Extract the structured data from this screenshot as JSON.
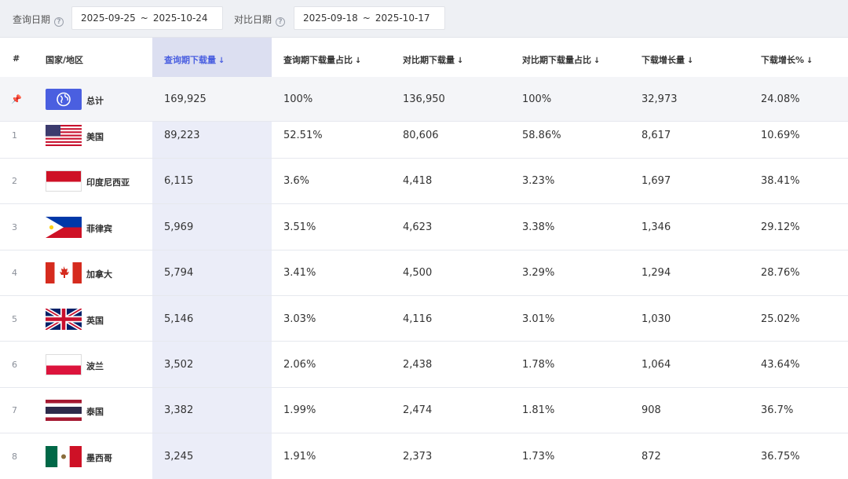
{
  "filters": {
    "query_label": "查询日期",
    "query_start": "2025-09-25",
    "query_end": "2025-10-24",
    "compare_label": "对比日期",
    "compare_start": "2025-09-18",
    "compare_end": "2025-10-17",
    "range_separator": "~"
  },
  "table": {
    "headers": {
      "index": "#",
      "country": "国家/地区",
      "query_downloads": "查询期下载量",
      "query_share": "查询期下载量占比",
      "compare_downloads": "对比期下载量",
      "compare_share": "对比期下载量占比",
      "growth": "下载增长量",
      "growth_pct": "下载增长%"
    },
    "sort_arrow": "↓",
    "total": {
      "name": "总计",
      "flag_icon": "globe-icon",
      "query": "169,925",
      "query_share": "100%",
      "compare": "136,950",
      "compare_share": "100%",
      "growth": "32,973",
      "growth_pct": "24.08%"
    },
    "rows": [
      {
        "index": "1",
        "name": "美国",
        "flag_icon": "flag-us-icon",
        "query": "89,223",
        "query_share": "52.51%",
        "compare": "80,606",
        "compare_share": "58.86%",
        "growth": "8,617",
        "growth_pct": "10.69%"
      },
      {
        "index": "2",
        "name": "印度尼西亚",
        "flag_icon": "flag-id-icon",
        "query": "6,115",
        "query_share": "3.6%",
        "compare": "4,418",
        "compare_share": "3.23%",
        "growth": "1,697",
        "growth_pct": "38.41%"
      },
      {
        "index": "3",
        "name": "菲律宾",
        "flag_icon": "flag-ph-icon",
        "query": "5,969",
        "query_share": "3.51%",
        "compare": "4,623",
        "compare_share": "3.38%",
        "growth": "1,346",
        "growth_pct": "29.12%"
      },
      {
        "index": "4",
        "name": "加拿大",
        "flag_icon": "flag-ca-icon",
        "query": "5,794",
        "query_share": "3.41%",
        "compare": "4,500",
        "compare_share": "3.29%",
        "growth": "1,294",
        "growth_pct": "28.76%"
      },
      {
        "index": "5",
        "name": "英国",
        "flag_icon": "flag-gb-icon",
        "query": "5,146",
        "query_share": "3.03%",
        "compare": "4,116",
        "compare_share": "3.01%",
        "growth": "1,030",
        "growth_pct": "25.02%"
      },
      {
        "index": "6",
        "name": "波兰",
        "flag_icon": "flag-pl-icon",
        "query": "3,502",
        "query_share": "2.06%",
        "compare": "2,438",
        "compare_share": "1.78%",
        "growth": "1,064",
        "growth_pct": "43.64%"
      },
      {
        "index": "7",
        "name": "泰国",
        "flag_icon": "flag-th-icon",
        "query": "3,382",
        "query_share": "1.99%",
        "compare": "2,474",
        "compare_share": "1.81%",
        "growth": "908",
        "growth_pct": "36.7%"
      },
      {
        "index": "8",
        "name": "墨西哥",
        "flag_icon": "flag-mx-icon",
        "query": "3,245",
        "query_share": "1.91%",
        "compare": "2,373",
        "compare_share": "1.73%",
        "growth": "872",
        "growth_pct": "36.75%"
      }
    ]
  },
  "colors": {
    "accent": "#4a5fe0",
    "highlight_column": "#ebedf8",
    "topbar_bg": "#eef0f4"
  }
}
